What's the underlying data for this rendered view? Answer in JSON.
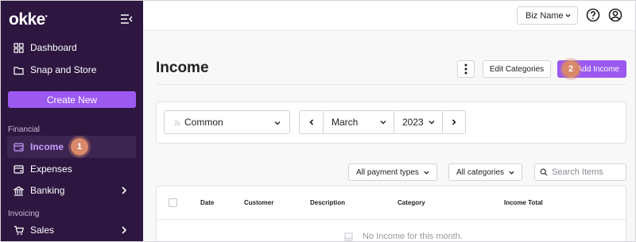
{
  "app": {
    "logo": "okke"
  },
  "sidebar": {
    "items_top": [
      {
        "label": "Dashboard",
        "icon": "grid-icon"
      },
      {
        "label": "Snap and Store",
        "icon": "folder-icon"
      }
    ],
    "create_label": "Create New",
    "section_financial": "Financial",
    "financial_items": [
      {
        "label": "Income",
        "icon": "income-icon",
        "active": true
      },
      {
        "label": "Expenses",
        "icon": "expenses-icon"
      },
      {
        "label": "Banking",
        "icon": "bank-icon"
      }
    ],
    "section_invoicing": "Invoicing",
    "invoicing_items": [
      {
        "label": "Sales",
        "icon": "cart-icon"
      }
    ]
  },
  "annotations": {
    "step1": "1",
    "step2": "2"
  },
  "topbar": {
    "business_name": "Biz Name"
  },
  "main": {
    "title": "Income",
    "edit_categories_label": "Edit Categories",
    "add_income_label": "Add Income",
    "filters": {
      "category_set": "Common",
      "month": "March",
      "year": "2023"
    },
    "list_filters": {
      "payment_types": "All payment types",
      "categories": "All categories",
      "search_placeholder": "Search Items"
    },
    "table": {
      "columns": [
        "Date",
        "Customer",
        "Description",
        "Category",
        "Income Total"
      ],
      "empty_message": "No Income for this month."
    }
  },
  "colors": {
    "sidebar_bg": "#2d1640",
    "accent": "#9b59f0",
    "active_text": "#c79cff",
    "badge": "#d9896a"
  }
}
